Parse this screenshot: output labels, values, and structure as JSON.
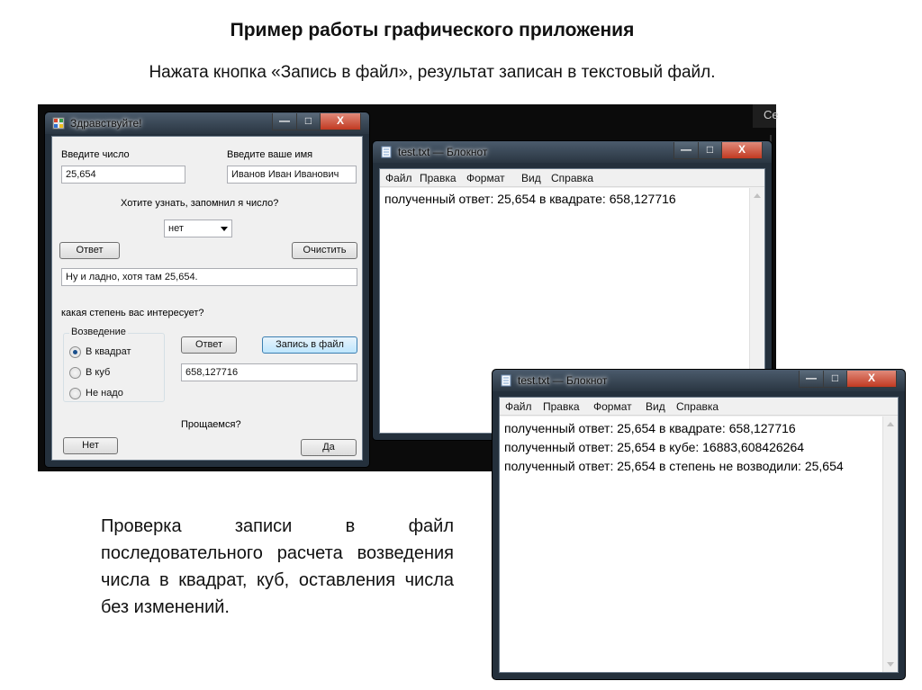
{
  "slide": {
    "title": "Пример работы графического приложения",
    "subtitle": "Нажата кнопка «Запись в файл», результат записан в текстовый файл.",
    "description": "Проверка записи в файл последовательного расчета возведения числа в квадрат, куб, оставления числа без изменений.",
    "bg_corner_text": "Се"
  },
  "app_window": {
    "title": "Здравствуйте!",
    "controls": {
      "minimize": "—",
      "maximize": "□",
      "close": "X"
    },
    "number_label": "Введите число",
    "number_value": "25,654",
    "name_label": "Введите ваше имя",
    "name_value": "Иванов Иван Иванович",
    "question": "Хотите узнать, запомнил я число?",
    "combo_value": "нет",
    "answer_button": "Ответ",
    "clear_button": "Очистить",
    "response_text": "Ну и ладно, хотя там 25,654.",
    "power_question": "какая степень вас интересует?",
    "group_title": "Возведение",
    "radios": [
      {
        "label": "В квадрат",
        "checked": true
      },
      {
        "label": "В куб",
        "checked": false
      },
      {
        "label": "Не надо",
        "checked": false
      }
    ],
    "answer_button_2": "Ответ",
    "write_file_button": "Запись в файл",
    "result_value": "658,127716",
    "goodbye": "Прощаемся?",
    "no_button": "Нет",
    "yes_button": "Да"
  },
  "notepad1": {
    "title": "test.txt — Блокнот",
    "controls": {
      "minimize": "—",
      "maximize": "□",
      "close": "X"
    },
    "menu": [
      "Файл",
      "Правка",
      "Формат",
      "Вид",
      "Справка"
    ],
    "lines": [
      "полученный ответ: 25,654 в квадрате: 658,127716"
    ]
  },
  "notepad2": {
    "title": "test.txt — Блокнот",
    "controls": {
      "minimize": "—",
      "maximize": "□",
      "close": "X"
    },
    "menu": [
      "Файл",
      "Правка",
      "Формат",
      "Вид",
      "Справка"
    ],
    "lines": [
      "полученный ответ: 25,654 в квадрате: 658,127716",
      "полученный ответ: 25,654 в кубе: 16883,608426264",
      "полученный ответ: 25,654 в степень не возводили: 25,654"
    ]
  },
  "colors": {
    "accent": "#1a4f8c",
    "frame": "#24303c",
    "desktop": "#0b0b0b"
  },
  "icons": {
    "app": "window-app-icon",
    "notepad": "notepad-icon"
  }
}
